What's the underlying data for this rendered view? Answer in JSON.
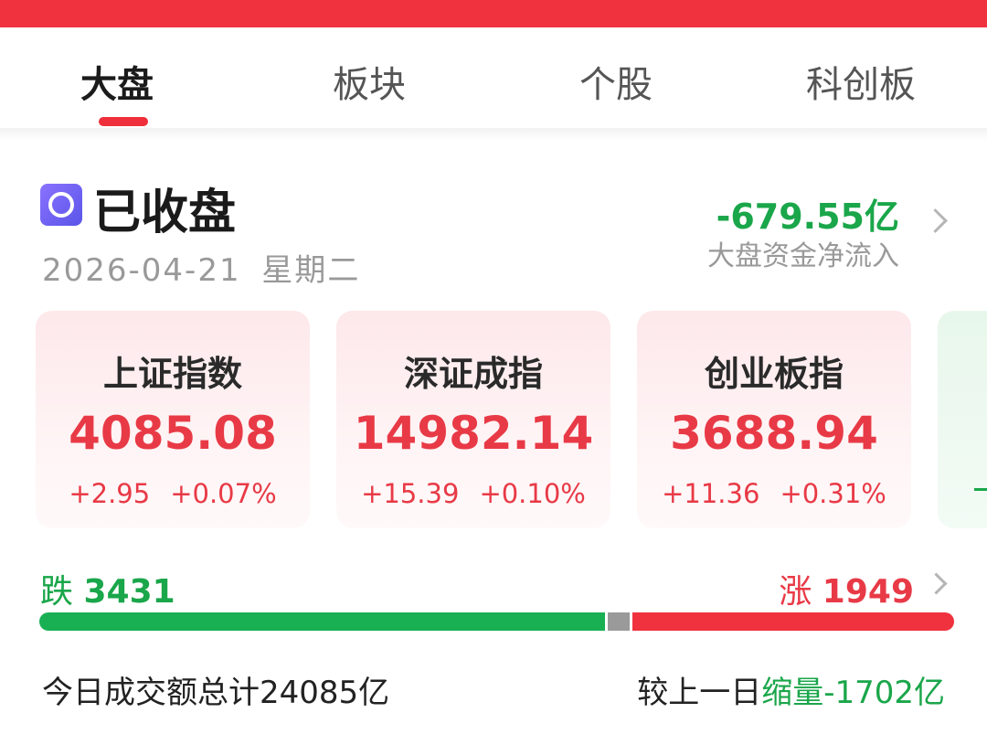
{
  "colors": {
    "accent_red": "#f0313e",
    "rise": "#e83a46",
    "fall": "#1aa64a",
    "flat": "#9a9a9a"
  },
  "tabs": [
    {
      "label": "大盘",
      "active": true
    },
    {
      "label": "板块",
      "active": false
    },
    {
      "label": "个股",
      "active": false
    },
    {
      "label": "科创板",
      "active": false
    }
  ],
  "market_status": {
    "icon": "market-closed-icon",
    "title": "已收盘",
    "date": "2026-04-21",
    "weekday": "星期二"
  },
  "capital_flow": {
    "value": "-679.55亿",
    "label": "大盘资金净流入"
  },
  "indices": [
    {
      "name": "上证指数",
      "value": "4085.08",
      "change": "+2.95",
      "pct": "+0.07%"
    },
    {
      "name": "深证成指",
      "value": "14982.14",
      "change": "+15.39",
      "pct": "+0.10%"
    },
    {
      "name": "创业板指",
      "value": "3688.94",
      "change": "+11.36",
      "pct": "+0.31%"
    }
  ],
  "breadth": {
    "down_label": "跌",
    "down_count": "3431",
    "up_label": "涨",
    "up_count": "1949",
    "down_fraction": 0.621,
    "flat_fraction": 0.024,
    "up_fraction": 0.355
  },
  "turnover": {
    "label": "今日成交额总计",
    "amount": "24085亿",
    "compare_label": "较上一日",
    "compare_kind": "缩量",
    "compare_value": "-1702亿"
  }
}
